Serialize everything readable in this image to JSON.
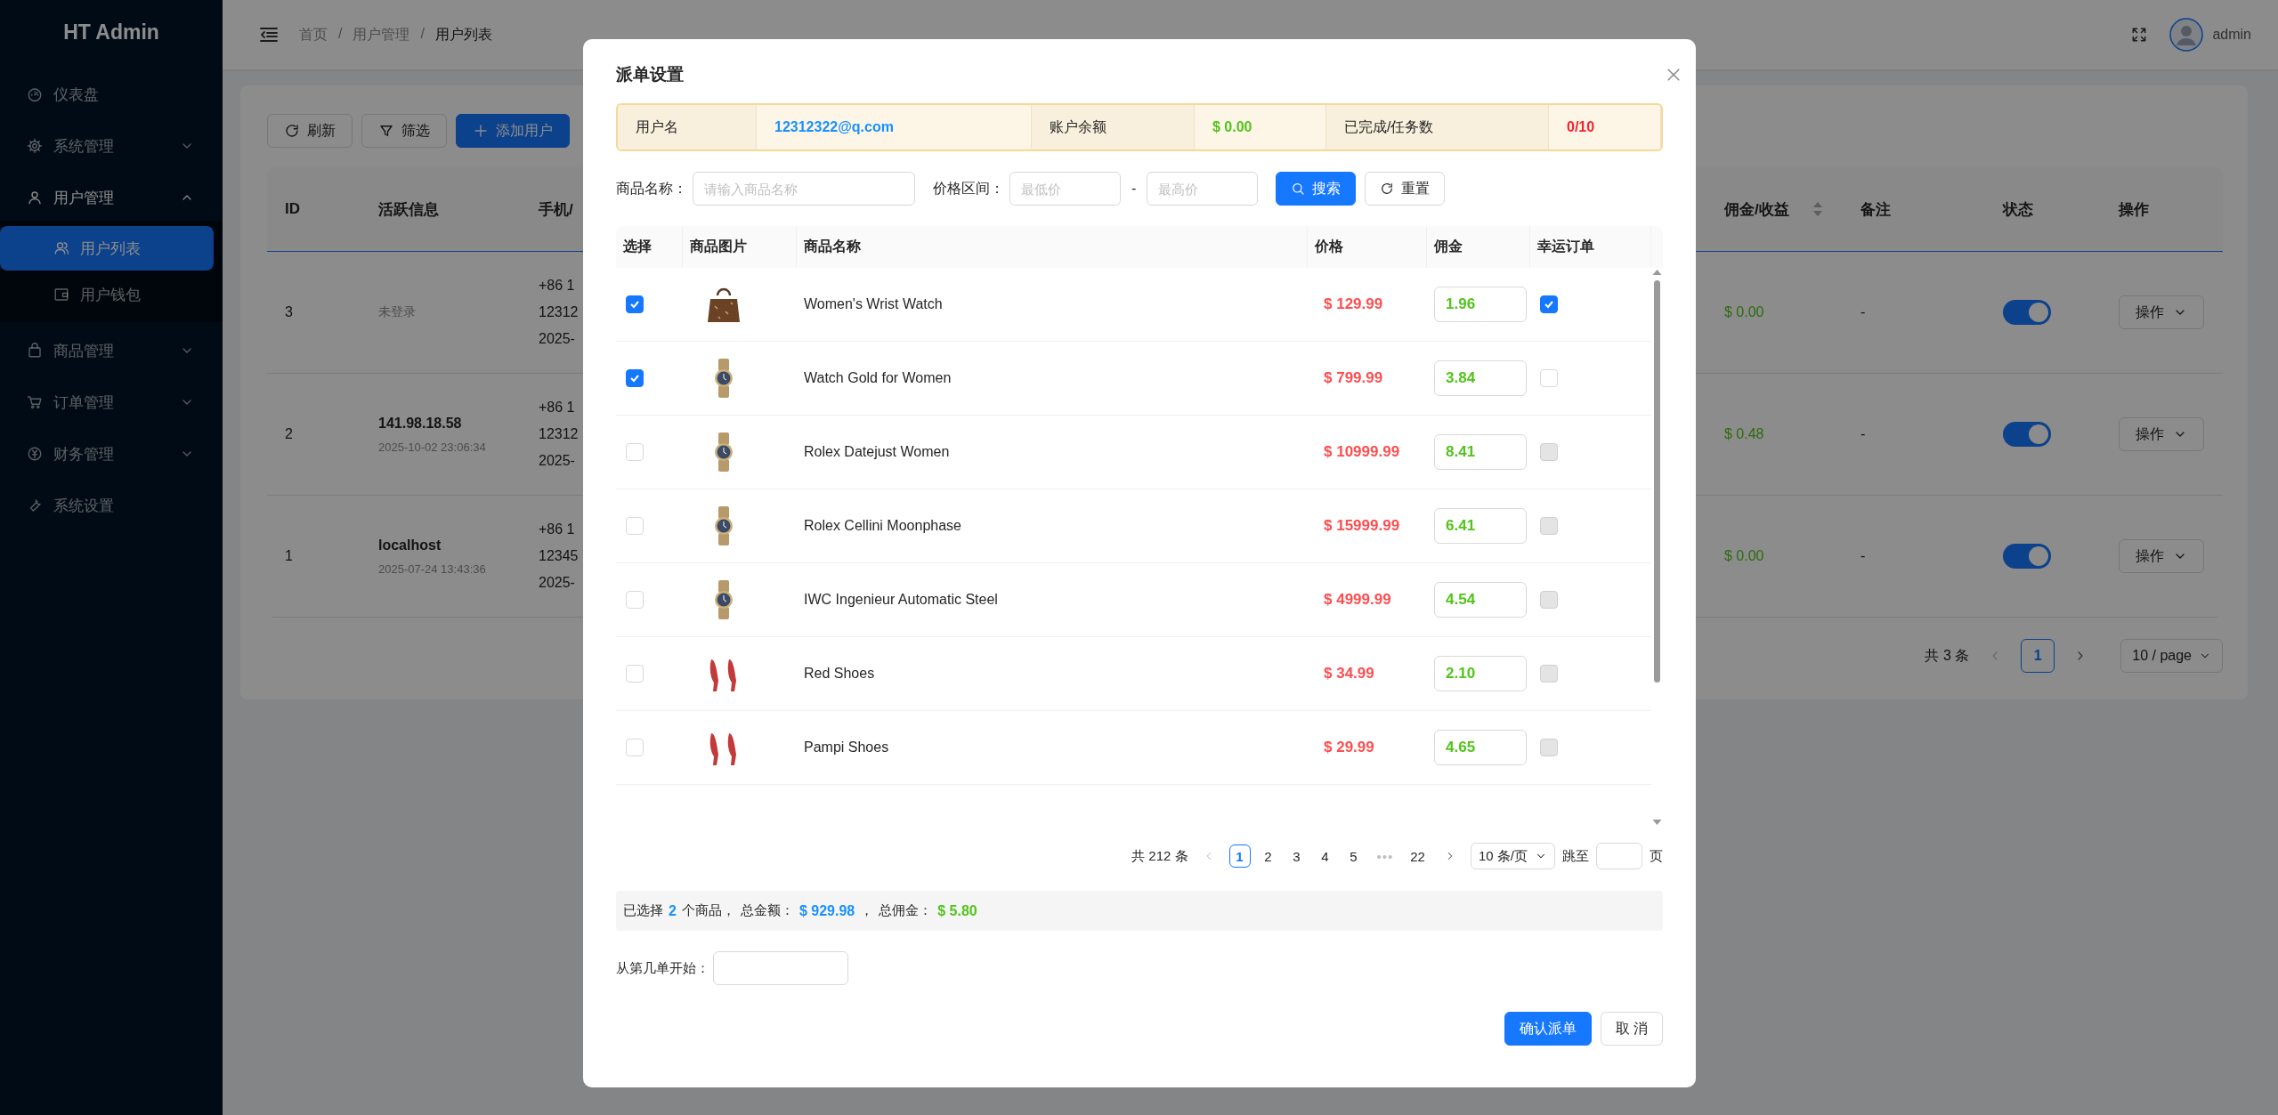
{
  "sidebar": {
    "logo": "HT Admin",
    "items": [
      {
        "label": "仪表盘",
        "selected": false
      },
      {
        "label": "系统管理",
        "selected": false,
        "expanded": false
      },
      {
        "label": "用户管理",
        "selected": false,
        "expanded": true,
        "children": [
          {
            "label": "用户列表",
            "selected": true
          },
          {
            "label": "用户钱包",
            "selected": false
          }
        ]
      },
      {
        "label": "商品管理",
        "selected": false,
        "expanded": false
      },
      {
        "label": "订单管理",
        "selected": false,
        "expanded": false
      },
      {
        "label": "财务管理",
        "selected": false,
        "expanded": false
      },
      {
        "label": "系统设置",
        "selected": false
      }
    ]
  },
  "header": {
    "breadcrumb": [
      "首页",
      "用户管理",
      "用户列表"
    ],
    "separator": "/",
    "user": "admin"
  },
  "toolbar": [
    {
      "label": "刷新",
      "kind": "default"
    },
    {
      "label": "筛选",
      "kind": "default"
    },
    {
      "label": "添加用户",
      "kind": "primary"
    }
  ],
  "users": {
    "columns_left": [
      {
        "label": "ID"
      },
      {
        "label": "活跃信息"
      },
      {
        "label": "手机/"
      }
    ],
    "columns_right": [
      {
        "label": "佣金/收益",
        "kind": "sortable"
      },
      {
        "label": "备注",
        "kind": "plain"
      },
      {
        "label": "状态",
        "kind": "plain"
      },
      {
        "label": "操作",
        "kind": "plain"
      }
    ],
    "rows": [
      {
        "id": "3",
        "activity": "未登录",
        "kind": "status",
        "phone_lines": [
          "+86 1",
          "12312",
          "2025-"
        ],
        "commission": "$ 0.00",
        "note": "-",
        "status_on": true,
        "action": "操作"
      },
      {
        "id": "2",
        "activity": "141.98.18.58",
        "kind": "ip",
        "activity_time": "2025-10-02 23:06:34",
        "phone_lines": [
          "+86 1",
          "12312",
          "2025-"
        ],
        "commission": "$ 0.48",
        "note": "-",
        "status_on": true,
        "action": "操作"
      },
      {
        "id": "1",
        "activity": "localhost",
        "kind": "ip",
        "activity_time": "2025-07-24 13:43:36",
        "phone_lines": [
          "+86 1",
          "12345",
          "2025-"
        ],
        "commission": "$ 0.00",
        "note": "-",
        "status_on": true,
        "action": "操作"
      }
    ],
    "pagination": {
      "total": "共 3 条",
      "pages": [
        {
          "label": "1",
          "selected": true
        }
      ],
      "page_size": "10 / page"
    }
  },
  "dialog": {
    "title": "派单设置",
    "info": [
      {
        "label": "用户名",
        "value": "12312322@q.com",
        "kind": "accent"
      },
      {
        "label": "账户余额",
        "value": "$ 0.00",
        "kind": "positive"
      },
      {
        "label": "已完成/任务数",
        "value": "0/10",
        "kind": "negative"
      }
    ],
    "filters": {
      "name": {
        "label": "商品名称：",
        "placeholder": "请输入商品名称"
      },
      "price": {
        "label": "价格区间：",
        "min_placeholder": "最低价",
        "separator": "-",
        "max_placeholder": "最高价"
      },
      "search": "搜索",
      "reset": "重置"
    },
    "table": {
      "columns": [
        "选择",
        "商品图片",
        "商品名称",
        "价格",
        "佣金",
        "幸运订单"
      ],
      "rows": [
        {
          "selected": true,
          "kind": "bag",
          "name": "Women's Wrist Watch",
          "price": "$ 129.99",
          "commission": "1.96",
          "lucky": {
            "checked": true,
            "disabled": false
          }
        },
        {
          "selected": true,
          "kind": "watch",
          "name": "Watch Gold for Women",
          "price": "$ 799.99",
          "commission": "3.84",
          "lucky": {
            "checked": false,
            "disabled": false
          }
        },
        {
          "selected": false,
          "kind": "watch",
          "name": "Rolex Datejust Women",
          "price": "$ 10999.99",
          "commission": "8.41",
          "lucky": {
            "checked": false,
            "disabled": true
          }
        },
        {
          "selected": false,
          "kind": "watch",
          "name": "Rolex Cellini Moonphase",
          "price": "$ 15999.99",
          "commission": "6.41",
          "lucky": {
            "checked": false,
            "disabled": true
          }
        },
        {
          "selected": false,
          "kind": "watch",
          "name": "IWC Ingenieur Automatic Steel",
          "price": "$ 4999.99",
          "commission": "4.54",
          "lucky": {
            "checked": false,
            "disabled": true
          }
        },
        {
          "selected": false,
          "kind": "heels",
          "name": "Red Shoes",
          "price": "$ 34.99",
          "commission": "2.10",
          "lucky": {
            "checked": false,
            "disabled": true
          }
        },
        {
          "selected": false,
          "kind": "heels",
          "name": "Pampi Shoes",
          "price": "$ 29.99",
          "commission": "4.65",
          "lucky": {
            "checked": false,
            "disabled": true
          }
        }
      ]
    },
    "pagination": {
      "total": "共 212 条",
      "pages": [
        {
          "label": "1",
          "kind": "page",
          "selected": true
        },
        {
          "label": "2",
          "kind": "page",
          "selected": false
        },
        {
          "label": "3",
          "kind": "page",
          "selected": false
        },
        {
          "label": "4",
          "kind": "page",
          "selected": false
        },
        {
          "label": "5",
          "kind": "page",
          "selected": false
        },
        {
          "label": "•••",
          "kind": "jump",
          "selected": false
        },
        {
          "label": "22",
          "kind": "page",
          "selected": false
        }
      ],
      "page_size": "10 条/页",
      "jump_label": "跳至",
      "jump_suffix": "页"
    },
    "summary": [
      {
        "text": "已选择",
        "kind": "plain"
      },
      {
        "text": "2",
        "kind": "accent"
      },
      {
        "text": "个商品，",
        "kind": "plain"
      },
      {
        "text": "总金额：",
        "kind": "plain"
      },
      {
        "text": "$ 929.98",
        "kind": "accent"
      },
      {
        "text": "，",
        "kind": "plain"
      },
      {
        "text": "总佣金：",
        "kind": "plain"
      },
      {
        "text": "$ 5.80",
        "kind": "positive"
      }
    ],
    "start": {
      "label": "从第几单开始："
    },
    "buttons": [
      {
        "label": "确认派单",
        "kind": "primary"
      },
      {
        "label": "取 消",
        "kind": "default"
      }
    ]
  }
}
